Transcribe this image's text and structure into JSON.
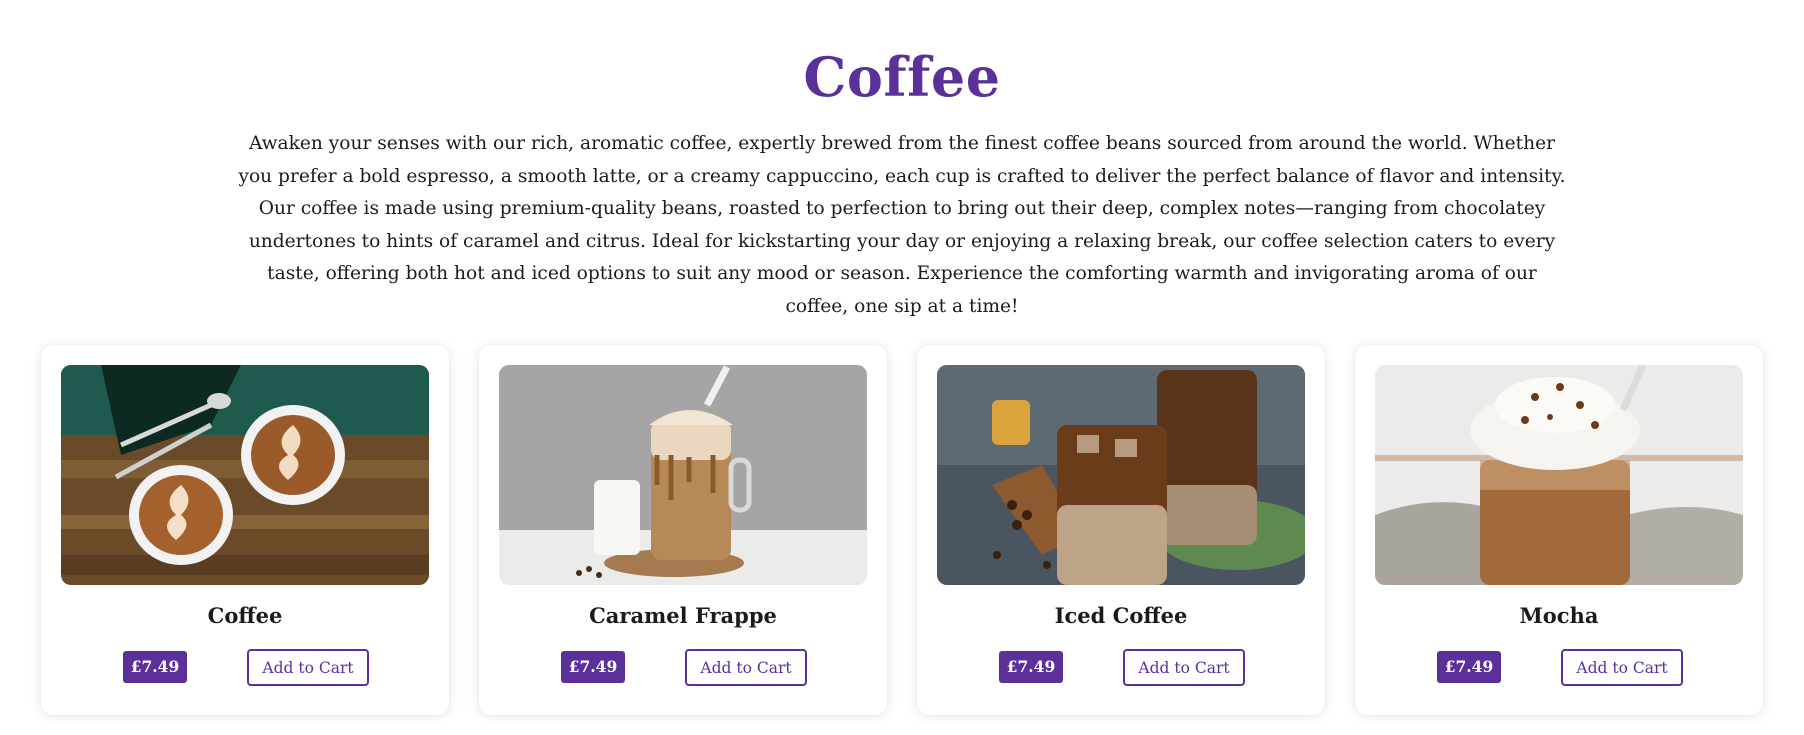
{
  "header": {
    "title": "Coffee",
    "description": "Awaken your senses with our rich, aromatic coffee, expertly brewed from the finest coffee beans sourced from around the world. Whether you prefer a bold espresso, a smooth latte, or a creamy cappuccino, each cup is crafted to deliver the perfect balance of flavor and intensity. Our coffee is made using premium-quality beans, roasted to perfection to bring out their deep, complex notes—ranging from chocolatey undertones to hints of caramel and citrus. Ideal for kickstarting your day or enjoying a relaxing break, our coffee selection caters to every taste, offering both hot and iced options to suit any mood or season. Experience the comforting warmth and invigorating aroma of our coffee, one sip at a time!"
  },
  "theme": {
    "accent": "#5b3199",
    "card_bg": "#ffffff"
  },
  "products": [
    {
      "name": "Coffee",
      "price": "£7.49",
      "cart_label": "Add to Cart",
      "image": "latte-art-cups-photo"
    },
    {
      "name": "Caramel Frappe",
      "price": "£7.49",
      "cart_label": "Add to Cart",
      "image": "caramel-frappe-jar-photo"
    },
    {
      "name": "Iced Coffee",
      "price": "£7.49",
      "cart_label": "Add to Cart",
      "image": "iced-coffee-glasses-photo"
    },
    {
      "name": "Mocha",
      "price": "£7.49",
      "cart_label": "Add to Cart",
      "image": "mocha-whipped-cream-photo"
    }
  ]
}
